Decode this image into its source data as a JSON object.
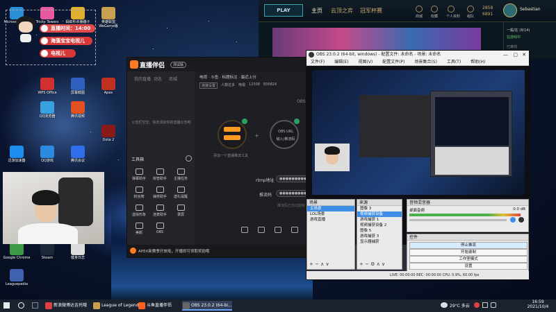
{
  "desktop_icons": [
    {
      "label": "Microsoft Edge",
      "color": "#2b8fd8"
    },
    {
      "label": "Tricky Towers",
      "color": "#e85aa0"
    },
    {
      "label": "蚂蚁秒杀播器子",
      "color": "#e0b030"
    },
    {
      "label": "英雄联盟 WeGame版",
      "color": "#c8a050"
    },
    {
      "label": "WPS Office",
      "color": "#d03030"
    },
    {
      "label": "屏幕截图",
      "color": "#3060c0"
    },
    {
      "label": "Apex",
      "color": "#c03020"
    },
    {
      "label": "QQ浏览器",
      "color": "#3aa0e0"
    },
    {
      "label": "腾讯视频",
      "color": "#e05020"
    },
    {
      "label": "Dota 2",
      "color": "#8a1a1a"
    },
    {
      "label": "QQ游戏",
      "color": "#2c8ae0"
    },
    {
      "label": "腾讯会议",
      "color": "#2f6fe8"
    },
    {
      "label": "迅游加速器",
      "color": "#1d8df0"
    },
    {
      "label": "Google Chrome",
      "color": "#3b9b45"
    },
    {
      "label": "Steam",
      "color": "#1b2838"
    },
    {
      "label": "健身日志",
      "color": "#dddddd"
    },
    {
      "label": "Leaguepedia",
      "color": "#4060b0"
    }
  ],
  "overlay": {
    "timer": "直播时间：14:00",
    "line1": "海藻宝宝电视儿",
    "line2": "电视儿"
  },
  "lol_client": {
    "play": "PLAY",
    "tabs": [
      "主页",
      "云顶之弈",
      "冠军杯赛"
    ],
    "icons": [
      "商城",
      "收藏",
      "个人资料",
      "组队"
    ],
    "rp": "2858",
    "be": "6891",
    "username": "Sebastian",
    "friends": [
      "一般/在 (8/14)",
      "在游戏中",
      "已离线"
    ]
  },
  "companion": {
    "app_name": "直播伴侣",
    "badge": "测试版",
    "top_left_tabs": [
      "我的直播",
      "动态",
      "商城"
    ],
    "top_right": "电视 · 斗鱼 · 标题标注 · 最近上分",
    "stats": [
      "连接设置",
      "人数过多",
      "电视",
      "12308",
      "835824"
    ],
    "empty_hint": "公告栏空空，快去添加你的直播公告吧",
    "tools_title": "工具箱",
    "tools": [
      "弹幕助手",
      "房管助手",
      "主播任务",
      "粉丝牌",
      "抽奖助手",
      "送礼提醒",
      "虚拟形象",
      "连麦助手",
      "录屏",
      "美颜",
      "OBS"
    ],
    "step1_label": "添加一个直播推流工具",
    "step2_label": "OBS URL",
    "step2_sub": "输入/推流码",
    "field1_label": "rtmp地址",
    "field2_label": "推流码",
    "field_placeholder": "●●●●●●●●●●●●●●●●",
    "field_note": "推流码已自动复制",
    "bottom_icons": [
      "设置",
      "录屏",
      "美颜",
      "连麦"
    ],
    "warning": "APEX新赛季开放啦，开播即可领取奖励哦"
  },
  "obs": {
    "title": "OBS 23.0.2 (64-bit, windows) - 配置文件: 未命名 - 场景: 未命名",
    "menu": [
      "文件(F)",
      "编辑(E)",
      "视图(V)",
      "配置文件(P)",
      "场景集合(S)",
      "工具(T)",
      "帮助(H)"
    ],
    "scenes_title": "场景",
    "scenes": [
      "主场景",
      "LOL场景",
      "游戏直播"
    ],
    "sources_title": "来源",
    "sources": [
      "图像 3",
      "视频捕获设备",
      "游戏捕获 1",
      "视频捕获设备 2",
      "图像 5",
      "游戏捕获 3",
      "显示器捕获"
    ],
    "mixer_title": "音频混音器",
    "mixer_label": "桌面音频",
    "mixer_db": "0.0 dB",
    "controls_title": "控件",
    "controls": [
      "停止推流",
      "开始录制",
      "工作室模式",
      "设置",
      "退出"
    ],
    "status": "LIVE: 00:00:00    REC: 00:00:00    CPU: 0.9%, 60.00 fps"
  },
  "taskbar": {
    "items": [
      {
        "label": "新浪微博达吉托哦",
        "color": "#e04040"
      },
      {
        "label": "League of Legends",
        "color": "#c8a050"
      },
      {
        "label": "斗鱼直播伴侣",
        "color": "#ff6020"
      },
      {
        "label": "OBS 23.0.2 (64-bi...",
        "color": "#666666"
      }
    ],
    "weather": "29°C 多云",
    "time": "16:59",
    "date": "2021/10/4"
  }
}
